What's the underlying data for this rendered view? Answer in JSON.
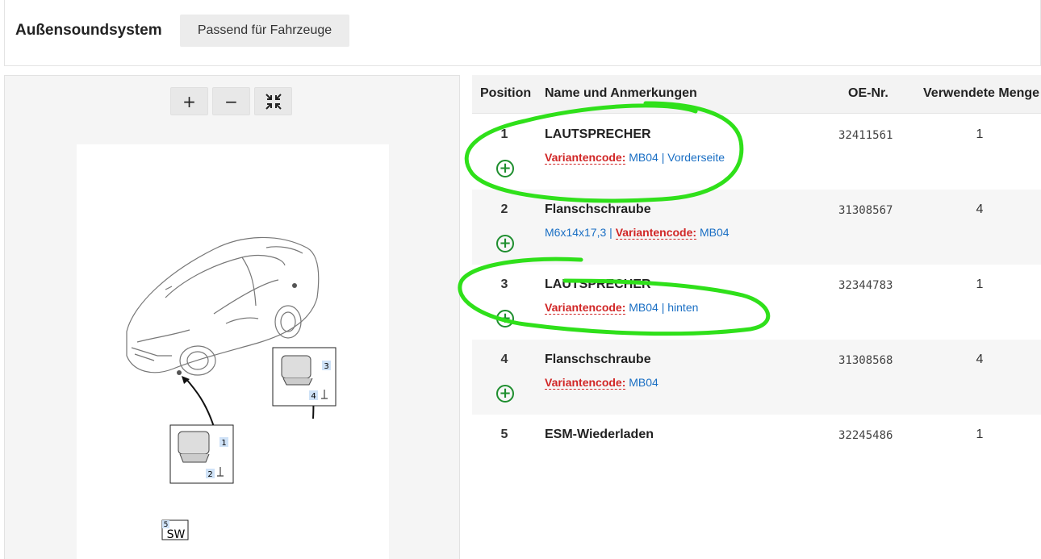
{
  "header": {
    "title": "Außensoundsystem",
    "fit_button": "Passend für Fahrzeuge"
  },
  "diagram": {
    "zoom_in": "+",
    "zoom_out": "−",
    "fit_icon": "collapse-arrows-icon",
    "callouts": [
      "1",
      "2",
      "3",
      "4",
      "5"
    ],
    "sw_label": "SW"
  },
  "table": {
    "headers": {
      "position": "Position",
      "name": "Name und Anmerkungen",
      "oe": "OE-Nr.",
      "qty": "Verwendete Menge"
    },
    "rows": [
      {
        "position": "1",
        "name": "LAUTSPRECHER",
        "pre": "",
        "vc_label": "Variantencode:",
        "post": " MB04 | Vorderseite",
        "oe": "32411561",
        "qty": "1"
      },
      {
        "position": "2",
        "name": "Flanschschraube",
        "pre": "M6x14x17,3 | ",
        "vc_label": "Variantencode:",
        "post": " MB04",
        "oe": "31308567",
        "qty": "4"
      },
      {
        "position": "3",
        "name": "LAUTSPRECHER",
        "pre": "",
        "vc_label": "Variantencode:",
        "post": " MB04 | hinten",
        "oe": "32344783",
        "qty": "1"
      },
      {
        "position": "4",
        "name": "Flanschschraube",
        "pre": "",
        "vc_label": "Variantencode:",
        "post": " MB04",
        "oe": "31308568",
        "qty": "4"
      },
      {
        "position": "5",
        "name": "ESM-Wiederladen",
        "pre": "",
        "vc_label": "",
        "post": "",
        "oe": "32245486",
        "qty": "1"
      }
    ]
  },
  "colors": {
    "variant_code": "#d12626",
    "link_blue": "#1a6fc4",
    "add_green": "#1e8e2e",
    "highlight": "#2fe01a"
  }
}
